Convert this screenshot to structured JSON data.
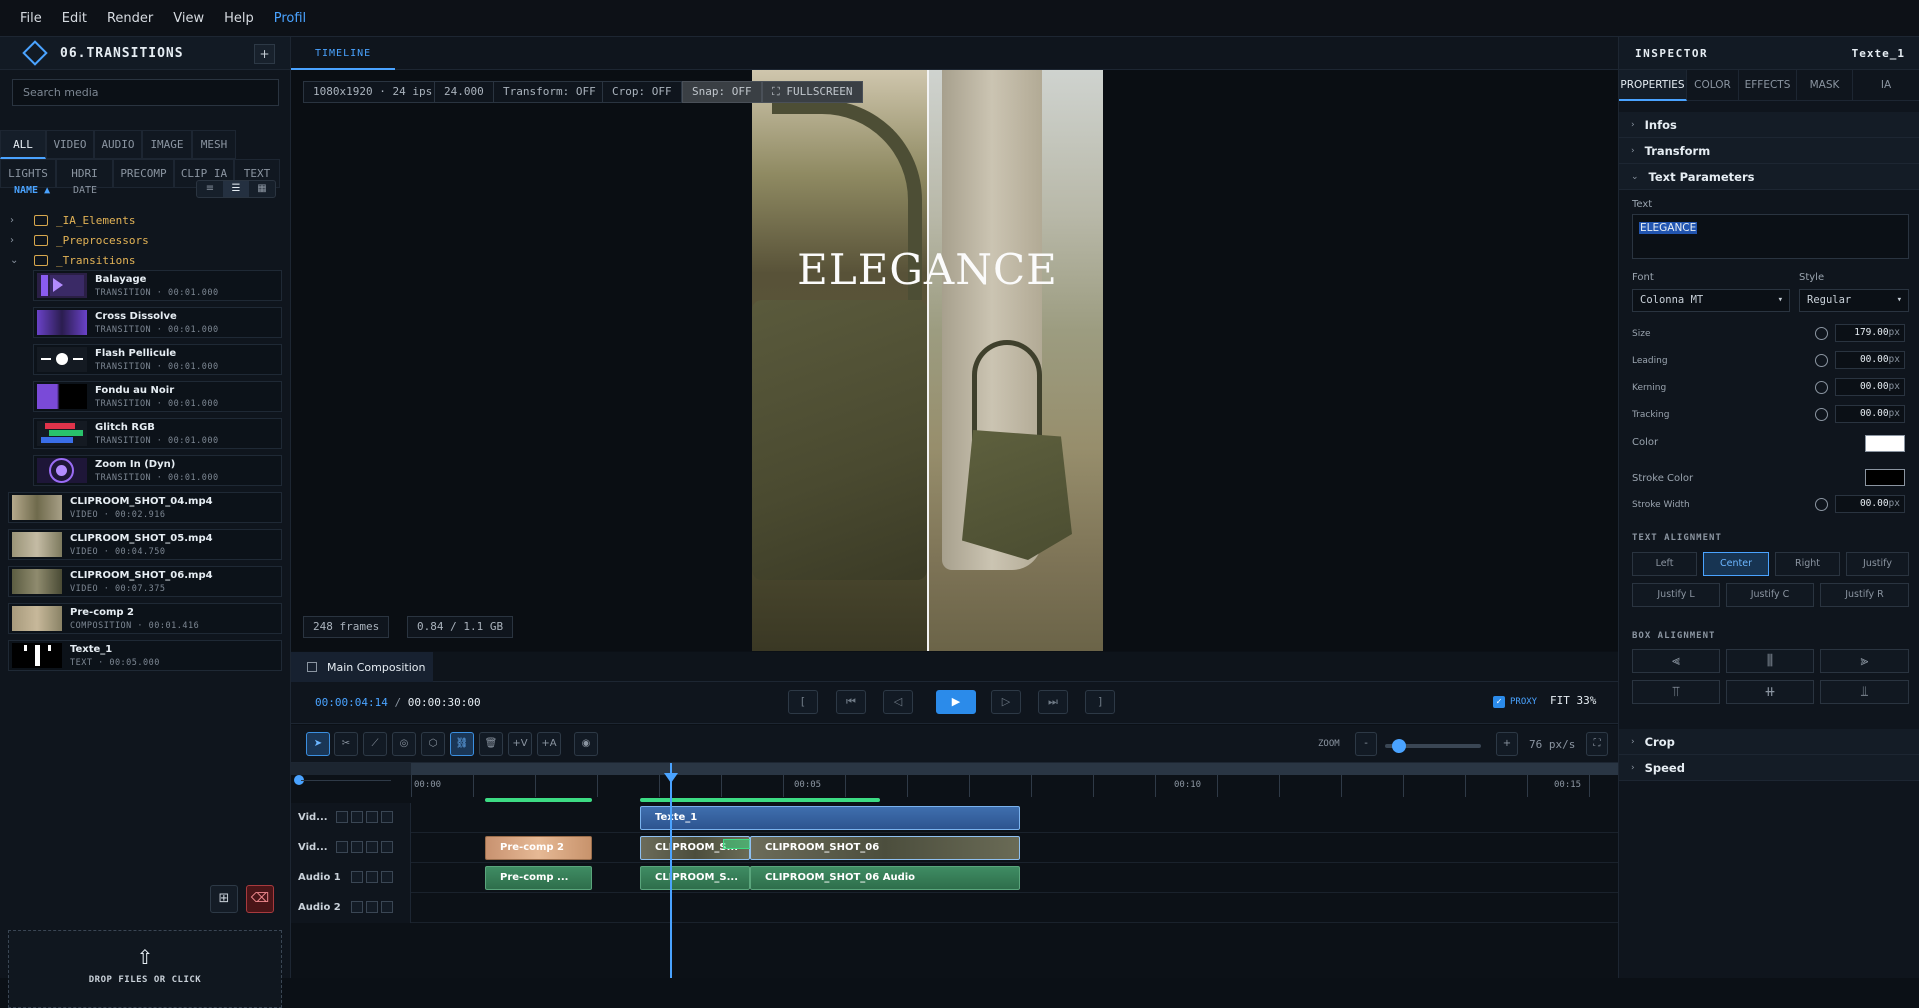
{
  "menu": [
    "File",
    "Edit",
    "Render",
    "View",
    "Help",
    "Profil"
  ],
  "project": {
    "title": "06.TRANSITIONS",
    "add_label": "+"
  },
  "media": {
    "search_placeholder": "Search media",
    "filter_row1": [
      "ALL",
      "VIDEO",
      "AUDIO",
      "IMAGE",
      "MESH"
    ],
    "filter_row2": [
      "LIGHTS",
      "HDRI",
      "PRECOMP",
      "CLIP IA",
      "TEXT"
    ],
    "sort_name": "NAME ▲",
    "sort_date": "DATE",
    "folders": [
      {
        "name": "_IA_Elements",
        "chevron": "›"
      },
      {
        "name": "_Preprocessors",
        "chevron": "›"
      },
      {
        "name": "_Transitions",
        "chevron": "⌄"
      }
    ],
    "transitions": [
      {
        "name": "Balayage",
        "meta": "TRANSITION · 00:01.000"
      },
      {
        "name": "Cross Dissolve",
        "meta": "TRANSITION · 00:01.000"
      },
      {
        "name": "Flash Pellicule",
        "meta": "TRANSITION · 00:01.000"
      },
      {
        "name": "Fondu au Noir",
        "meta": "TRANSITION · 00:01.000"
      },
      {
        "name": "Glitch RGB",
        "meta": "TRANSITION · 00:01.000"
      },
      {
        "name": "Zoom In (Dyn)",
        "meta": "TRANSITION · 00:01.000"
      }
    ],
    "items": [
      {
        "name": "CLIPROOM_SHOT_04.mp4",
        "meta": "VIDEO · 00:02.916"
      },
      {
        "name": "CLIPROOM_SHOT_05.mp4",
        "meta": "VIDEO · 00:04.750"
      },
      {
        "name": "CLIPROOM_SHOT_06.mp4",
        "meta": "VIDEO · 00:07.375"
      },
      {
        "name": "Pre-comp 2",
        "meta": "COMPOSITION · 00:01.416"
      },
      {
        "name": "Texte_1",
        "meta": "TEXT · 00:05.000"
      }
    ],
    "drop_label": "DROP FILES OR CLICK",
    "drop_icon": "⇧"
  },
  "viewer": {
    "tab": "TIMELINE",
    "resolution": "1080x1920 · 24 ips",
    "fps": "24.000",
    "transform": "Transform: OFF",
    "crop": "Crop: OFF",
    "snap": "Snap: OFF",
    "fullscreen": "⛶ FULLSCREEN",
    "frames": "248 frames",
    "memory": "0.84 / 1.1 GB",
    "overlay_text": "ELEGANCE"
  },
  "composition": {
    "tab": "Main Composition"
  },
  "transport": {
    "current": "00:00:04:14",
    "separator": "/",
    "duration": "00:00:30:00",
    "proxy": "PROXY",
    "fit": "FIT 33%"
  },
  "toolbar": {
    "zoom_label": "ZOOM",
    "zoom_minus": "-",
    "zoom_plus": "+",
    "zoom_value": "76 px/s"
  },
  "timeline": {
    "ruler_labels": [
      "00:00",
      "00:05",
      "00:10",
      "00:15"
    ],
    "tracks": [
      "Vid...",
      "Vid...",
      "Audio 1",
      "Audio 2"
    ],
    "clips": {
      "texte": "Texte_1",
      "precomp_v": "Pre-comp 2",
      "shot_s_v": "CLIPROOM_S...",
      "shot06_v": "CLIPROOM_SHOT_06",
      "precomp_a": "Pre-comp ...",
      "shot_s_a": "CLIPROOM_S...",
      "shot06_a": "CLIPROOM_SHOT_06 Audio"
    }
  },
  "inspector": {
    "title": "INSPECTOR",
    "selected": "Texte_1",
    "tabs": [
      "PROPERTIES",
      "COLOR",
      "EFFECTS",
      "MASK",
      "IA"
    ],
    "sections": {
      "infos": "Infos",
      "transform": "Transform",
      "text_params": "Text Parameters",
      "crop": "Crop",
      "speed": "Speed"
    },
    "text_label": "Text",
    "text_value": "ELEGANCE",
    "font_label": "Font",
    "font_value": "Colonna MT",
    "style_label": "Style",
    "style_value": "Regular",
    "size_label": "Size",
    "size_value": "179.00",
    "leading_label": "Leading",
    "leading_value": "00.00",
    "kerning_label": "Kerning",
    "kerning_value": "00.00",
    "tracking_label": "Tracking",
    "tracking_value": "00.00",
    "unit": "px",
    "color_label": "Color",
    "color_value": "#ffffff",
    "stroke_color_label": "Stroke Color",
    "stroke_color_value": "#000000",
    "stroke_width_label": "Stroke Width",
    "stroke_width_value": "00.00",
    "text_alignment_label": "TEXT ALIGNMENT",
    "align_row1": [
      "Left",
      "Center",
      "Right",
      "Justify"
    ],
    "align_row2": [
      "Justify L",
      "Justify C",
      "Justify R"
    ],
    "box_alignment_label": "BOX ALIGNMENT"
  }
}
